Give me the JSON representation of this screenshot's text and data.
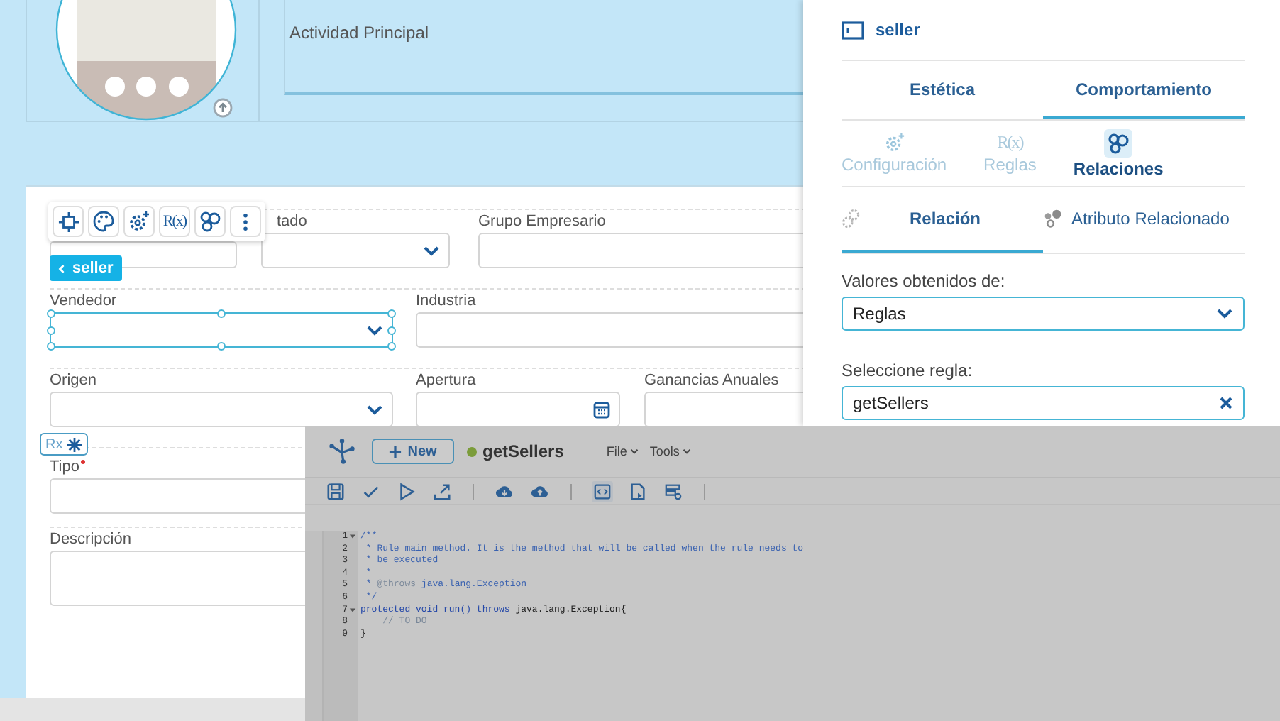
{
  "header": {
    "activity_label": "Actividad Principal"
  },
  "form": {
    "rows": [
      {
        "fields": [
          {
            "kind": "text",
            "selected": false
          },
          {
            "label": "tado",
            "kind": "select",
            "selected": false
          },
          {
            "label": "Grupo Empresario",
            "kind": "text",
            "selected": false
          }
        ]
      },
      {
        "fields": [
          {
            "label": "Vendedor",
            "kind": "select",
            "selected": true
          },
          {
            "label": "Industria",
            "kind": "text",
            "selected": false
          }
        ]
      },
      {
        "fields": [
          {
            "label": "Origen",
            "kind": "select",
            "selected": false
          },
          {
            "label": "Apertura",
            "kind": "date",
            "selected": false
          },
          {
            "label": "Ganancias Anuales",
            "kind": "text",
            "selected": false
          }
        ]
      },
      {
        "fields": [
          {
            "label": "Tipo",
            "kind": "text",
            "selected": false,
            "required": true
          }
        ]
      },
      {
        "fields": [
          {
            "label": "Descripción",
            "kind": "textarea",
            "selected": false
          }
        ]
      }
    ],
    "toolbar_rule_text": "R(x)",
    "chip": "seller",
    "rx_badge": "Rx"
  },
  "panel": {
    "title": "seller",
    "tabs": [
      {
        "label": "Estética",
        "selected": false
      },
      {
        "label": "Comportamiento",
        "selected": true
      }
    ],
    "subtabs": [
      {
        "label": "Configuración",
        "selected": false
      },
      {
        "label": "Reglas",
        "icon_text": "R(x)",
        "selected": false
      },
      {
        "label": "Relaciones",
        "selected": true
      }
    ],
    "relation_tabs": [
      {
        "label": "Relación",
        "selected": true
      },
      {
        "label": "Atributo Relacionado",
        "selected": false
      }
    ],
    "source_label": "Valores obtenidos de:",
    "source_value": "Reglas",
    "rule_label": "Seleccione regla:",
    "rule_value": "getSellers"
  },
  "editor": {
    "new_label": "New",
    "file_name": "getSellers",
    "menus": [
      "File",
      "Tools"
    ],
    "code_lines": [
      {
        "number": "1",
        "fold": true,
        "tokens": [
          {
            "text": "/**",
            "kind": "comment"
          }
        ]
      },
      {
        "number": "2",
        "fold": false,
        "tokens": [
          {
            "text": " * Rule main method. It is the method that will be called when the rule needs to",
            "kind": "comment"
          }
        ]
      },
      {
        "number": "3",
        "fold": false,
        "tokens": [
          {
            "text": " * be executed",
            "kind": "comment"
          }
        ]
      },
      {
        "number": "4",
        "fold": false,
        "tokens": [
          {
            "text": " *",
            "kind": "comment"
          }
        ]
      },
      {
        "number": "5",
        "fold": false,
        "tokens": [
          {
            "text": " * ",
            "kind": "comment"
          },
          {
            "text": "@throws",
            "kind": "tag"
          },
          {
            "text": " java.lang.Exception",
            "kind": "comment"
          }
        ]
      },
      {
        "number": "6",
        "fold": false,
        "tokens": [
          {
            "text": " */",
            "kind": "comment"
          }
        ]
      },
      {
        "number": "7",
        "fold": true,
        "tokens": [
          {
            "text": "protected void run() throws ",
            "kind": "keyword"
          },
          {
            "text": "java.lang.Exception{",
            "kind": "plain"
          }
        ]
      },
      {
        "number": "8",
        "fold": false,
        "tokens": [
          {
            "text": "    // TO DO",
            "kind": "tag"
          }
        ]
      },
      {
        "number": "9",
        "fold": false,
        "tokens": [
          {
            "text": "}",
            "kind": "plain"
          }
        ]
      }
    ]
  }
}
